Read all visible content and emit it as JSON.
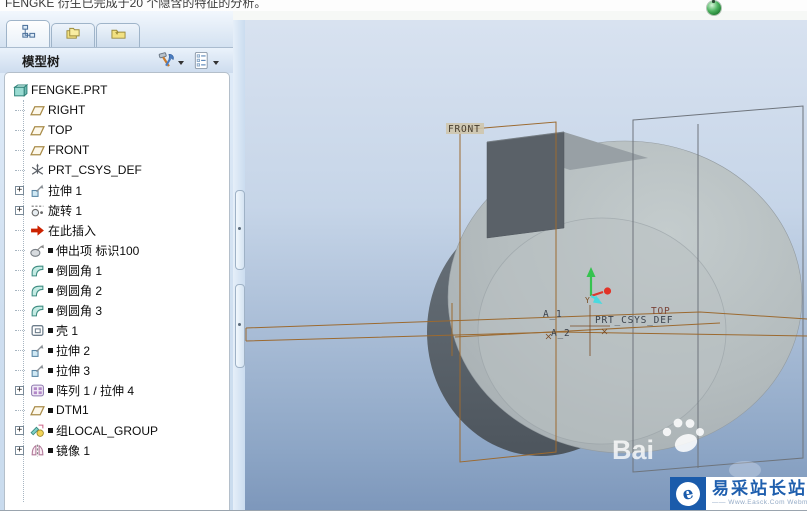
{
  "window": {
    "message": "FENGKE 衍生已完成于20 个隐含的特征的分析。",
    "status_icon": "regeneration-status-green-icon"
  },
  "panel": {
    "title": "模型树",
    "tabs": [
      {
        "name": "tab-model-tree",
        "icon": "model-tree-icon",
        "active": true
      },
      {
        "name": "tab-folder-browser",
        "icon": "folders-icon",
        "active": false
      },
      {
        "name": "tab-favorites",
        "icon": "favorites-folder-icon",
        "active": false
      }
    ],
    "toolbar": [
      {
        "name": "tree-tools-button",
        "icon": "tools-icon",
        "caret": "chevron-down-icon"
      },
      {
        "name": "tree-display-settings-button",
        "icon": "list-settings-icon",
        "caret": "chevron-down-icon"
      }
    ],
    "tree": [
      {
        "label": "FENGKE.PRT",
        "icon": "part-icon",
        "level": 0,
        "expandable": false,
        "suppressed": false
      },
      {
        "label": "RIGHT",
        "icon": "datum-plane-icon",
        "level": 1,
        "expandable": false,
        "suppressed": false
      },
      {
        "label": "TOP",
        "icon": "datum-plane-icon",
        "level": 1,
        "expandable": false,
        "suppressed": false
      },
      {
        "label": "FRONT",
        "icon": "datum-plane-icon",
        "level": 1,
        "expandable": false,
        "suppressed": false
      },
      {
        "label": "PRT_CSYS_DEF",
        "icon": "csys-icon",
        "level": 1,
        "expandable": false,
        "suppressed": false
      },
      {
        "label": "拉伸 1",
        "icon": "extrude-icon",
        "level": 1,
        "expandable": true,
        "suppressed": false
      },
      {
        "label": "旋转 1",
        "icon": "revolve-icon",
        "level": 1,
        "expandable": true,
        "suppressed": false
      },
      {
        "label": "在此插入",
        "icon": "insert-here-icon",
        "level": 1,
        "expandable": false,
        "suppressed": false
      },
      {
        "label": "伸出项 标识100",
        "icon": "protrusion-icon",
        "level": 1,
        "expandable": false,
        "suppressed": true
      },
      {
        "label": "倒圆角 1",
        "icon": "round-icon",
        "level": 1,
        "expandable": false,
        "suppressed": true
      },
      {
        "label": "倒圆角 2",
        "icon": "round-icon",
        "level": 1,
        "expandable": false,
        "suppressed": true
      },
      {
        "label": "倒圆角 3",
        "icon": "round-icon",
        "level": 1,
        "expandable": false,
        "suppressed": true
      },
      {
        "label": "壳 1",
        "icon": "shell-icon",
        "level": 1,
        "expandable": false,
        "suppressed": true
      },
      {
        "label": "拉伸 2",
        "icon": "extrude-icon",
        "level": 1,
        "expandable": false,
        "suppressed": true
      },
      {
        "label": "拉伸 3",
        "icon": "extrude-icon",
        "level": 1,
        "expandable": false,
        "suppressed": true
      },
      {
        "label": "阵列 1 / 拉伸 4",
        "icon": "pattern-icon",
        "level": 1,
        "expandable": true,
        "suppressed": true
      },
      {
        "label": "DTM1",
        "icon": "datum-plane-icon",
        "level": 1,
        "expandable": false,
        "suppressed": true
      },
      {
        "label": "组LOCAL_GROUP",
        "icon": "group-icon",
        "level": 1,
        "expandable": true,
        "suppressed": true
      },
      {
        "label": "镜像 1",
        "icon": "mirror-icon",
        "level": 1,
        "expandable": true,
        "suppressed": true
      }
    ]
  },
  "viewport": {
    "labels": {
      "front": "FRONT",
      "top": "TOP",
      "csys": "PRT_CSYS_DEF",
      "axis1": "A_1",
      "axis2": "A_2",
      "y_axis": "Y"
    },
    "watermark": {
      "text": "Bai",
      "icon": "paw-icon"
    },
    "badge": {
      "logo_icon": "easck-e-icon",
      "site": "易采站长站",
      "subtext": "—— Www.Easck.Com Webmaster"
    },
    "colors": {
      "vp_top": "#d8e2f0",
      "vp_bottom": "#7d97bb",
      "datum_brown": "#9c6a30",
      "datum_gray": "#6e747c",
      "solid_light": "#b4bcbe",
      "solid_dark": "#5b6268",
      "axis_green": "#35c34f",
      "axis_red": "#dd382c",
      "axis_cyan": "#49dadf",
      "logo_blue": "#1a5bab"
    }
  }
}
